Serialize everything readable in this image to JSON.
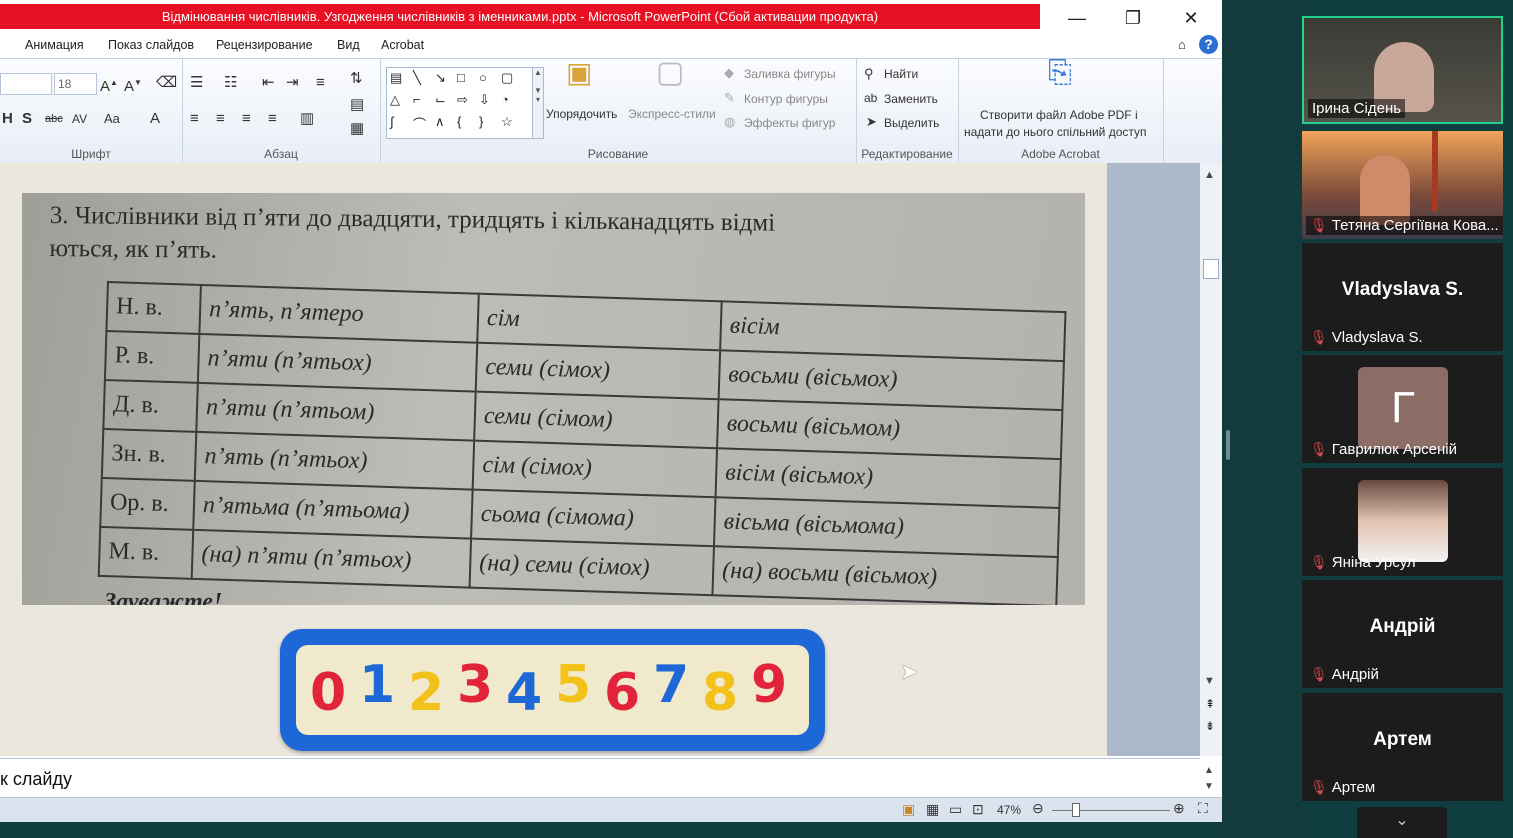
{
  "window": {
    "title": "Відмінювання числівників. Узгодження числівників з іменниками.pptx - Microsoft PowerPoint (Сбой активации продукта)",
    "minimize": "—",
    "restore": "❐",
    "close": "✕"
  },
  "menu": {
    "items": [
      "Анимация",
      "Показ слайдов",
      "Рецензирование",
      "Вид",
      "Acrobat"
    ]
  },
  "ribbon": {
    "font_size": "18",
    "groups": {
      "font": "Шрифт",
      "paragraph": "Абзац",
      "drawing": "Рисование",
      "editing": "Редактирование",
      "acrobat": "Adobe Acrobat"
    },
    "arrange": "Упорядочить",
    "express_styles": "Экспресс-стили",
    "fill": "Заливка фигуры",
    "outline": "Контур фигуры",
    "effects": "Эффекты фигур",
    "find": "Найти",
    "replace": "Заменить",
    "select": "Выделить",
    "acrobat_line1": "Створити файл Adobe PDF і",
    "acrobat_line2": "надати до нього спільний доступ"
  },
  "slide": {
    "heading_line1": "3. Числівники від п’яти до двадцяти, тридцять і кільканадцять відмі",
    "heading_line2": "ються, як п’ять.",
    "table": [
      [
        "Н. в.",
        "п’ять, п’ятеро",
        "сім",
        "вісім"
      ],
      [
        "Р. в.",
        "п’яти (п’ятьох)",
        "семи (сімох)",
        "восьми (вісьмох)"
      ],
      [
        "Д. в.",
        "п’яти (п’ятьом)",
        "семи (сімом)",
        "восьми (вісьмом)"
      ],
      [
        "Зн. в.",
        "п’ять (п’ятьох)",
        "сім (сімох)",
        "вісім (вісьмох)"
      ],
      [
        "Ор. в.",
        "п’ятьма (п’ятьома)",
        "сьома (сімома)",
        "вісьма (вісьмома)"
      ],
      [
        "М. в.",
        "(на) п’яти (п’ятьох)",
        "(на) семи (сімох)",
        "(на) восьми (вісьмох)"
      ]
    ],
    "note": "Зауважте!",
    "digits": [
      "0",
      "1",
      "2",
      "3",
      "4",
      "5",
      "6",
      "7",
      "8",
      "9"
    ],
    "digit_colors": [
      "#e2243a",
      "#1e67d6",
      "#f2c21b",
      "#e2243a",
      "#1e67d6",
      "#f2c21b",
      "#e2243a",
      "#1e67d6",
      "#f2c21b",
      "#e2243a"
    ]
  },
  "notes_text": "к слайду",
  "status": {
    "zoom": "47%"
  },
  "participants": [
    {
      "name": "Ірина Сідень",
      "video": true,
      "muted": false
    },
    {
      "name": "Тетяна Сергіївна Кова...",
      "video": true,
      "muted": true
    },
    {
      "name": "Vladyslava S.",
      "display": "Vladyslava S.",
      "video": false,
      "muted": true
    },
    {
      "name": "Гаврилюк Арсеній",
      "avatar_letter": "Г",
      "video": false,
      "muted": true
    },
    {
      "name": "Яніна Урсул",
      "video": false,
      "muted": true
    },
    {
      "name": "Андрій",
      "display": "Андрій",
      "video": false,
      "muted": true
    },
    {
      "name": "Артем",
      "display": "Артем",
      "video": false,
      "muted": true
    }
  ]
}
